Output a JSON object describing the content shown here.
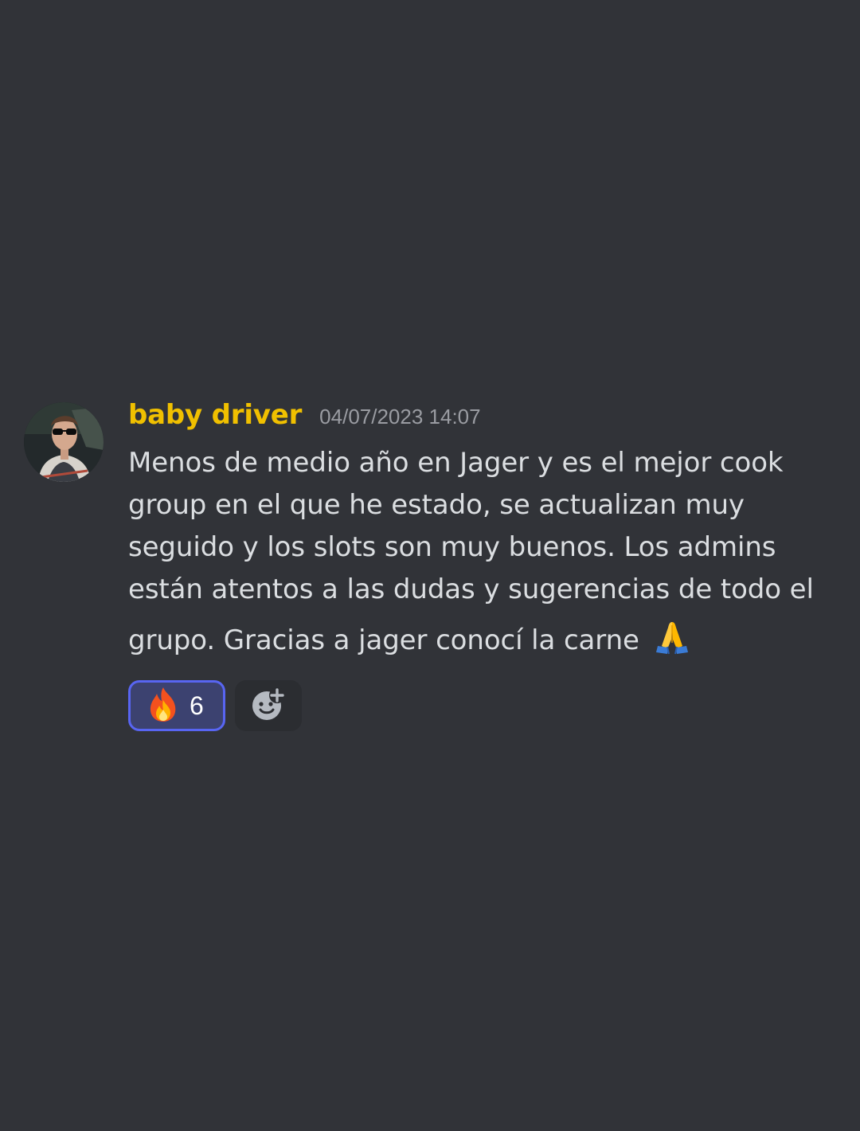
{
  "message": {
    "author": "baby driver",
    "author_color": "#f0c000",
    "timestamp": "04/07/2023 14:07",
    "avatar_icon": "user-avatar",
    "lines": [
      "Menos de medio año en Jager y es el mejor cook",
      "group en el que he estado, se actualizan muy",
      "seguido y los slots son muy buenos. Los admins",
      "están atentos a las dudas y sugerencias de todo el",
      "grupo. Gracias a jager conocí la carne"
    ],
    "trailing_emoji": "pray-emoji"
  },
  "reactions": [
    {
      "emoji": "fire-emoji",
      "count": "6",
      "active": true
    }
  ],
  "add_reaction": {
    "icon": "add-reaction-icon"
  },
  "colors": {
    "background": "#313338",
    "text": "#dbdee1",
    "timestamp": "#9a9ca2",
    "reaction_active_bg": "#3c4270",
    "reaction_active_border": "#5865f2",
    "add_reaction_bg": "#2b2d31"
  }
}
